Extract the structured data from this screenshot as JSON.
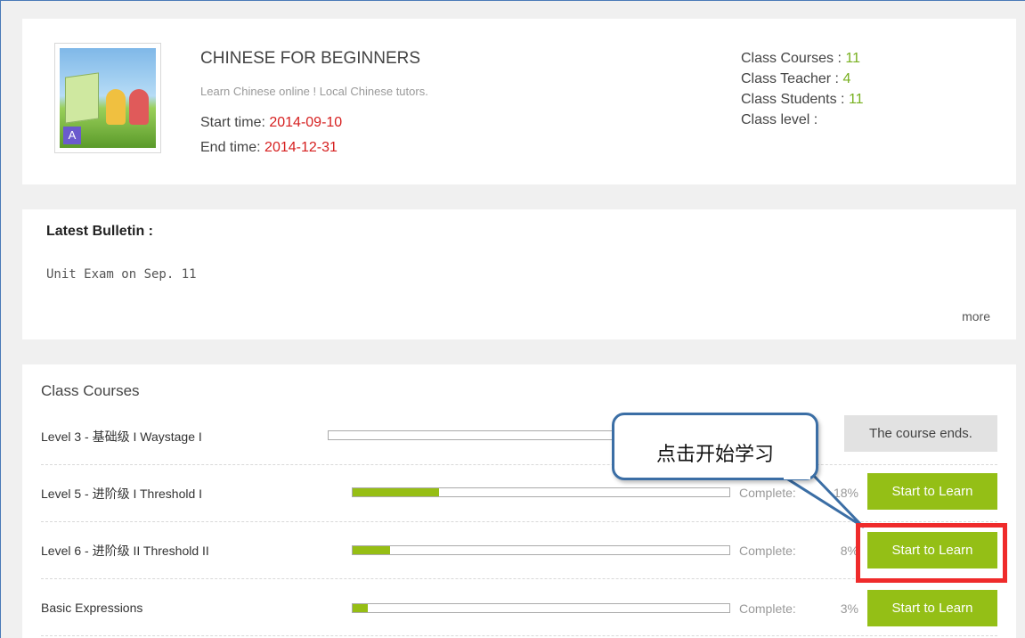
{
  "class_info": {
    "title": "CHINESE FOR BEGINNERS",
    "subtitle": "Learn Chinese online ! Local Chinese tutors.",
    "start_label": "Start time:",
    "start_date": "2014-09-10",
    "end_label": "End time:",
    "end_date": "2014-12-31",
    "stats": {
      "courses_label": "Class Courses :",
      "courses_value": "11",
      "teacher_label": "Class Teacher :",
      "teacher_value": "4",
      "students_label": "Class Students :",
      "students_value": "11",
      "level_label": "Class level :",
      "level_value": ""
    },
    "thumb_letter": "A"
  },
  "bulletin": {
    "title": "Latest Bulletin :",
    "item": "Unit Exam on Sep. 11",
    "more_label": "more"
  },
  "courses": {
    "title": "Class Courses",
    "complete_label": "Complete:",
    "rows": [
      {
        "name": "Level 3 - 基础级 I  Waystage I",
        "progress": 0,
        "percent": "",
        "button": "The course ends."
      },
      {
        "name": "Level 5 - 进阶级  I  Threshold  I",
        "progress": 0.23,
        "percent": "18%",
        "button": "Start to Learn"
      },
      {
        "name": "Level 6 - 进阶级  II  Threshold II",
        "progress": 0.1,
        "percent": "8%",
        "button": "Start to Learn"
      },
      {
        "name": "Basic Expressions",
        "progress": 0.04,
        "percent": "3%",
        "button": "Start to Learn"
      }
    ]
  },
  "annotation": {
    "callout_text": "点击开始学习",
    "highlight_color": "#ef2b2b",
    "callout_border_color": "#3b6ea5"
  },
  "colors": {
    "accent_green": "#94bf16",
    "date_red": "#d62020",
    "stat_green": "#78b020"
  }
}
